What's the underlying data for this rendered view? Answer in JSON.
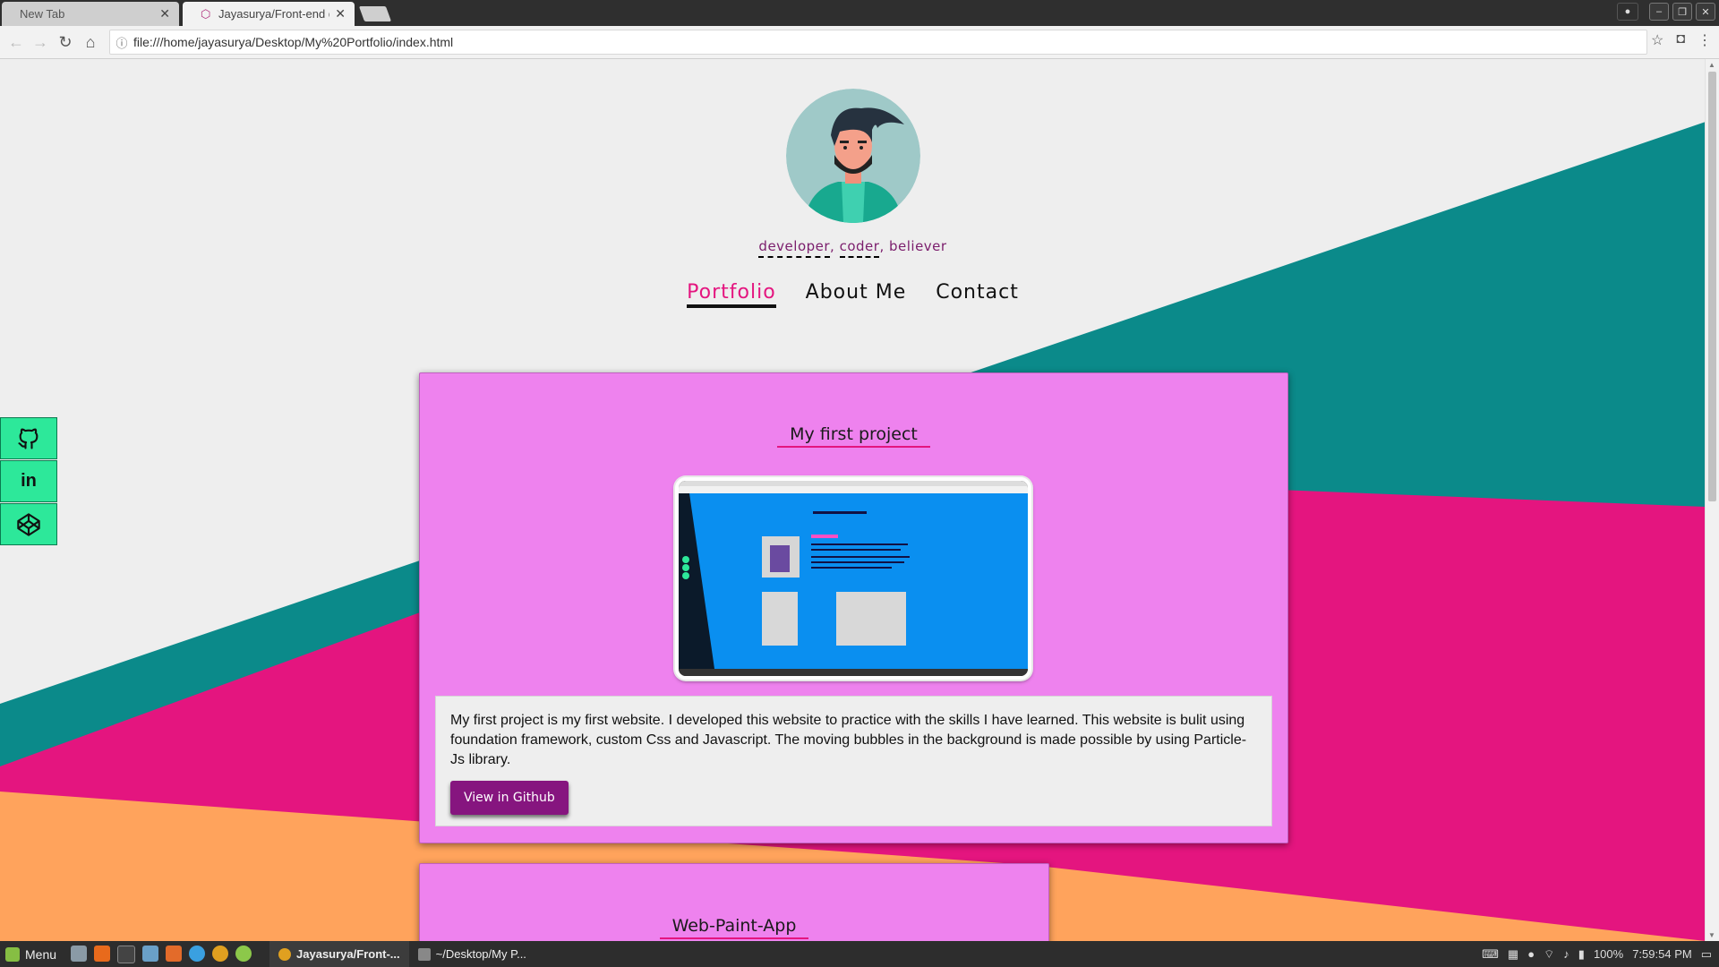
{
  "browser": {
    "tabs": [
      {
        "title": "New Tab",
        "active": false
      },
      {
        "title": "Jayasurya/Front-end de",
        "active": true
      }
    ],
    "url": "file:///home/jayasurya/Desktop/My%20Portfolio/index.html"
  },
  "page": {
    "tagline": {
      "word1": "developer",
      "sep1": ", ",
      "word2": "coder",
      "sep2": ", ",
      "word3": "believer"
    },
    "nav": [
      {
        "label": "Portfolio",
        "active": true
      },
      {
        "label": "About Me",
        "active": false
      },
      {
        "label": "Contact",
        "active": false
      }
    ],
    "social": [
      "github-icon",
      "linkedin-icon",
      "codepen-icon"
    ],
    "social_linkedin_text": "in",
    "projects": [
      {
        "title": "My first project",
        "description": "My first project is my first website. I developed this website to practice with the skills I have learned. This website is bulit using foundation framework, custom Css and Javascript. The moving bubbles in the background is made possible by using Particle-Js library.",
        "button": "View in Github"
      },
      {
        "title": "Web-Paint-App"
      }
    ],
    "colors": {
      "background": "#eeeeee",
      "teal": "#0b8a8a",
      "magenta": "#e4157f",
      "orange": "#ffa35c",
      "card": "#ee82ee",
      "button": "#86157f",
      "social": "#2de89a"
    }
  },
  "taskbar": {
    "menu": "Menu",
    "tasks": [
      {
        "label": "Jayasurya/Front-...",
        "active": true
      },
      {
        "label": "~/Desktop/My P...",
        "active": false
      }
    ],
    "battery": "100%",
    "time": "7:59:54 PM"
  }
}
